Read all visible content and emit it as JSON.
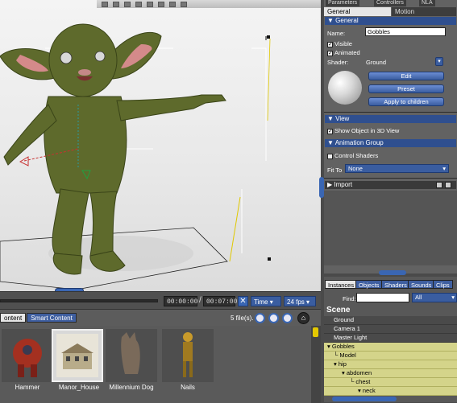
{
  "library": {
    "tabs": [
      "ontent",
      "Smart Content"
    ],
    "file_count": "5 file(s).",
    "items": [
      "Hammer",
      "Manor_House",
      "Millennium Dog",
      "Nails"
    ]
  },
  "timeline": {
    "current_time": "00:00:00",
    "end_time": "00:07:00",
    "separator": "/",
    "mode": "Time",
    "fps": "24 fps"
  },
  "params": {
    "top_tabs": [
      "Parameters",
      "Controllers",
      "NLA"
    ],
    "sub_tabs": [
      "General",
      "Motion"
    ],
    "general_header": "General",
    "name_label": "Name:",
    "name_value": "Gobbles",
    "visible_label": "Visible",
    "animated_label": "Animated",
    "shader_label": "Shader:",
    "shader_value": "Ground",
    "edit_label": "Edit",
    "preset_label": "Preset",
    "apply_label": "Apply to children",
    "view_header": "View",
    "show_3d_label": "Show Object in 3D View",
    "anim_header": "Animation Group",
    "control_shaders_label": "Control Shaders",
    "fit_to_label": "Fit To",
    "fit_to_value": "None",
    "import_header": "Import"
  },
  "scene": {
    "tabs": [
      "Instances",
      "Objects",
      "Shaders",
      "Sounds",
      "Clips"
    ],
    "find_label": "Find:",
    "find_value": "",
    "filter_value": "All",
    "title": "Scene",
    "rows": [
      "Ground",
      "Camera 1",
      "Master Light",
      "Gobbles",
      "Model",
      "hip",
      "abdomen",
      "chest",
      "neck"
    ]
  },
  "colors": {
    "accent": "#3a5da0",
    "selection": "#d4d48a",
    "character": "#5e6a2c"
  }
}
